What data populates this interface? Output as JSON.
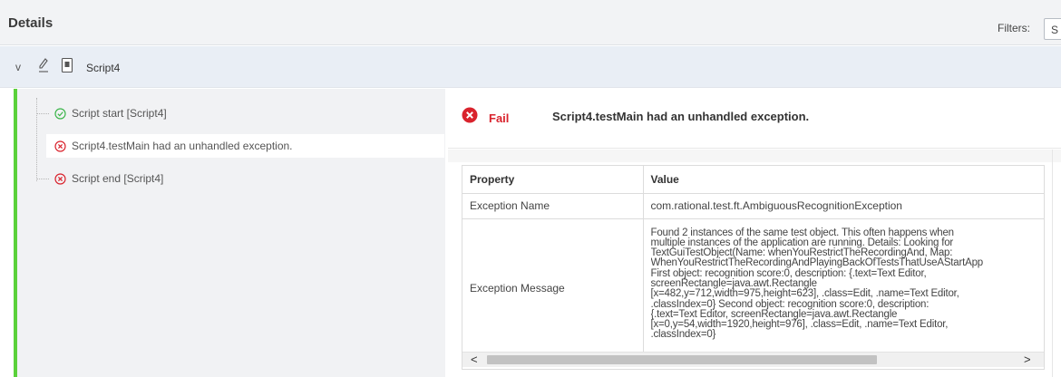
{
  "header": {
    "title": "Details",
    "filters_label": "Filters:",
    "filters_value": "S"
  },
  "script": {
    "name": "Script4"
  },
  "tree": {
    "items": [
      {
        "label": "Script start [Script4]",
        "status": "pass"
      },
      {
        "label": "Script4.testMain had an unhandled exception.",
        "status": "fail"
      },
      {
        "label": "Script end [Script4]",
        "status": "fail"
      }
    ]
  },
  "detail": {
    "status": "Fail",
    "message": "Script4.testMain had an unhandled exception.",
    "columns": [
      "Property",
      "Value"
    ],
    "rows": [
      {
        "property": "Exception Name",
        "value": "com.rational.test.ft.AmbiguousRecognitionException"
      },
      {
        "property": "Exception Message",
        "value": "Found 2 instances of the same test object. This often happens when\nmultiple instances of the application are running. Details: Looking for\nTextGuiTestObject(Name: whenYouRestrictTheRecordingAnd, Map:\nWhenYouRestrictTheRecordingAndPlayingBackOfTestsThatUseAStartApp\nFirst object: recognition score:0, description: {.text=Text Editor,\nscreenRectangle=java.awt.Rectangle\n[x=482,y=712,width=975,height=623], .class=Edit, .name=Text Editor,\n.classIndex=0} Second object: recognition score:0, description:\n{.text=Text Editor, screenRectangle=java.awt.Rectangle\n[x=0,y=54,width=1920,height=976], .class=Edit, .name=Text Editor,\n.classIndex=0}"
      }
    ]
  },
  "colors": {
    "pass": "#3bb54a",
    "fail": "#d9232d",
    "accent_bar": "#5ad13a"
  }
}
